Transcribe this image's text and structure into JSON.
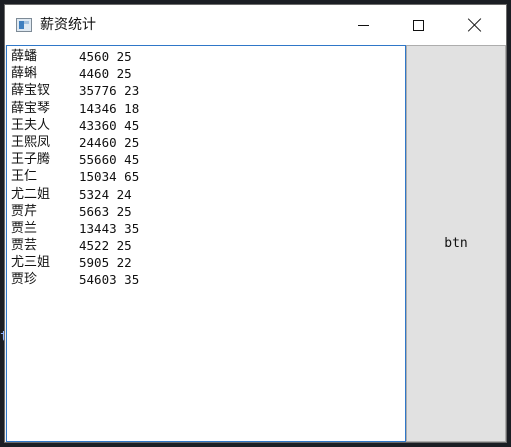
{
  "window": {
    "title": "薪资统计"
  },
  "background": {
    "glyph": "t"
  },
  "records": [
    {
      "name": "薛蟠",
      "salary": "4560",
      "age": "25"
    },
    {
      "name": "薛蝌",
      "salary": "4460",
      "age": "25"
    },
    {
      "name": "薛宝钗",
      "salary": "35776",
      "age": "23"
    },
    {
      "name": "薛宝琴",
      "salary": "14346",
      "age": "18"
    },
    {
      "name": "王夫人",
      "salary": "43360",
      "age": "45"
    },
    {
      "name": "王熙凤",
      "salary": "24460",
      "age": "25"
    },
    {
      "name": "王子腾",
      "salary": "55660",
      "age": "45"
    },
    {
      "name": "王仁",
      "salary": "15034",
      "age": "65"
    },
    {
      "name": "尤二姐",
      "salary": "5324",
      "age": "24"
    },
    {
      "name": "贾芹",
      "salary": "5663",
      "age": "25"
    },
    {
      "name": "贾兰",
      "salary": "13443",
      "age": "35"
    },
    {
      "name": "贾芸",
      "salary": "4522",
      "age": "25"
    },
    {
      "name": "尤三姐",
      "salary": "5905",
      "age": "22"
    },
    {
      "name": "贾珍",
      "salary": "54603",
      "age": "35"
    }
  ],
  "button": {
    "label": "btn"
  }
}
